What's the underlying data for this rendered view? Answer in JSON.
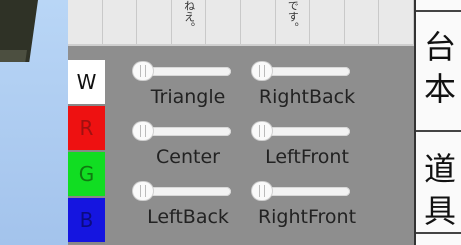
{
  "header_cells": [
    {
      "text": ""
    },
    {
      "text": ""
    },
    {
      "text": ""
    },
    {
      "text": "ねえ。"
    },
    {
      "text": ""
    },
    {
      "text": ""
    },
    {
      "text": "です。"
    },
    {
      "text": ""
    },
    {
      "text": ""
    },
    {
      "text": ""
    }
  ],
  "color_buttons": [
    {
      "label": "W",
      "color": "#ffffff"
    },
    {
      "label": "R",
      "color": "#ee1111"
    },
    {
      "label": "G",
      "color": "#11dd22"
    },
    {
      "label": "B",
      "color": "#1515e0"
    }
  ],
  "sliders": [
    {
      "label": "Triangle",
      "value": 0.0
    },
    {
      "label": "RightBack",
      "value": 0.0
    },
    {
      "label": "Center",
      "value": 0.0
    },
    {
      "label": "LeftFront",
      "value": 0.0
    },
    {
      "label": "LeftBack",
      "value": 0.0
    },
    {
      "label": "RightFront",
      "value": 0.0
    }
  ],
  "side_panel": {
    "chars": [
      "台",
      "本",
      "道",
      "具"
    ]
  }
}
